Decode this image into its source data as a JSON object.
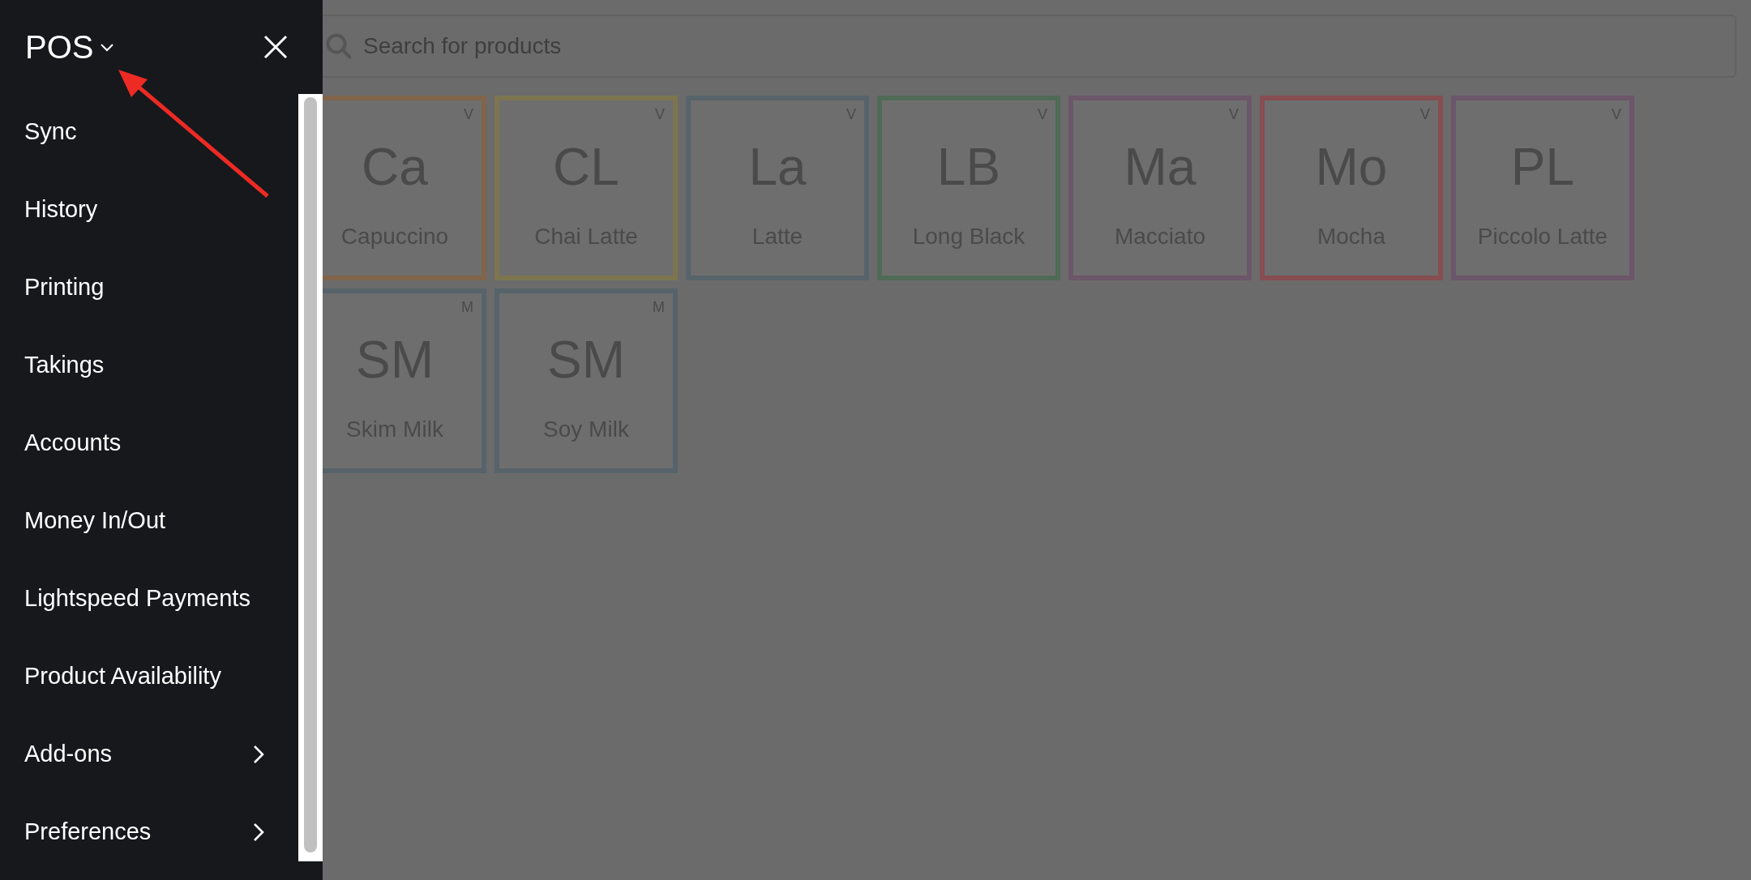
{
  "menu": {
    "title": "POS",
    "items": [
      {
        "label": "Sync",
        "kind": "link"
      },
      {
        "label": "History",
        "kind": "link"
      },
      {
        "label": "Printing",
        "kind": "link"
      },
      {
        "label": "Takings",
        "kind": "link"
      },
      {
        "label": "Accounts",
        "kind": "link"
      },
      {
        "label": "Money In/Out",
        "kind": "link"
      },
      {
        "label": "Lightspeed Payments",
        "kind": "link"
      },
      {
        "label": "Product Availability",
        "kind": "link"
      },
      {
        "label": "Add-ons",
        "kind": "submenu"
      },
      {
        "label": "Preferences",
        "kind": "submenu"
      }
    ]
  },
  "search": {
    "placeholder": "Search for products"
  },
  "products": [
    {
      "abbr": "Ca",
      "name": "Capuccino",
      "tag": "V",
      "color": "#80654a"
    },
    {
      "abbr": "CL",
      "name": "Chai Latte",
      "tag": "V",
      "color": "#7d7550"
    },
    {
      "abbr": "La",
      "name": "Latte",
      "tag": "V",
      "color": "#56636a"
    },
    {
      "abbr": "LB",
      "name": "Long Black",
      "tag": "V",
      "color": "#4f6b55"
    },
    {
      "abbr": "Ma",
      "name": "Macciato",
      "tag": "V",
      "color": "#6c566a"
    },
    {
      "abbr": "Mo",
      "name": "Mocha",
      "tag": "V",
      "color": "#864e50"
    },
    {
      "abbr": "PL",
      "name": "Piccolo Latte",
      "tag": "V",
      "color": "#6c566a"
    },
    {
      "abbr": "SM",
      "name": "Skim Milk",
      "tag": "M",
      "color": "#56636a"
    },
    {
      "abbr": "SM",
      "name": "Soy Milk",
      "tag": "M",
      "color": "#56636a"
    }
  ]
}
